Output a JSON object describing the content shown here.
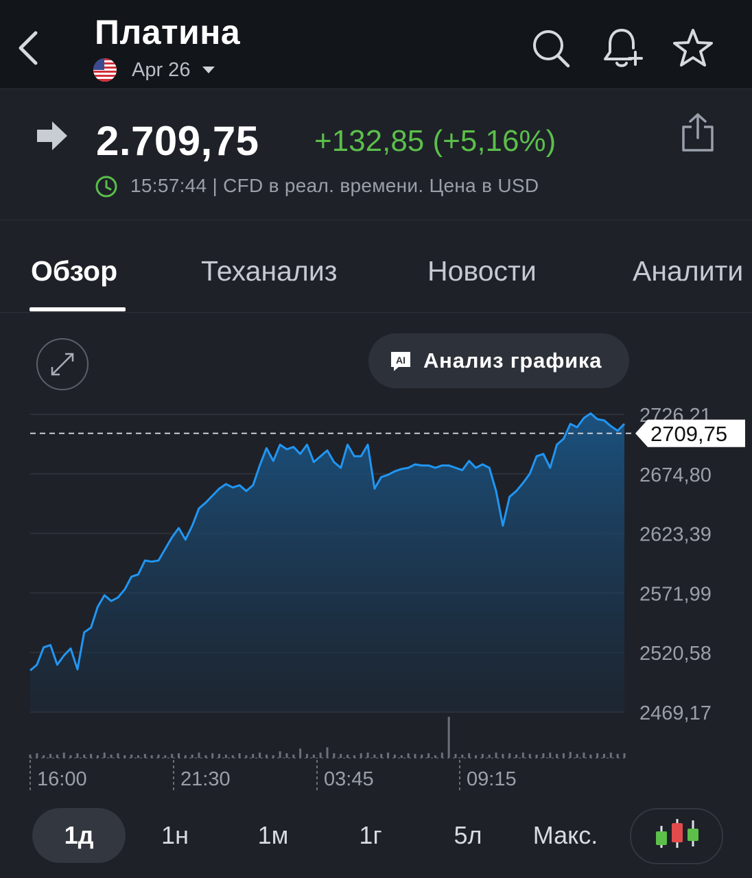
{
  "header": {
    "title": "Платина",
    "contract": "Apr 26"
  },
  "quote": {
    "price": "2.709,75",
    "change": "+132,85 (+5,16%)",
    "meta": "15:57:44 | CFD в реал. времени. Цена в USD",
    "colors": {
      "up": "#5bbf4a",
      "line": "#2196f3"
    }
  },
  "tabs": [
    {
      "label": "Обзор",
      "active": true
    },
    {
      "label": "Теханализ"
    },
    {
      "label": "Новости"
    },
    {
      "label": "Аналити"
    }
  ],
  "chart_tools": {
    "ai_badge": "AI",
    "ai_label": "Анализ графика"
  },
  "chart_data": {
    "type": "area",
    "y_ticks": [
      "2726,21",
      "2674,80",
      "2623,39",
      "2571,99",
      "2520,58",
      "2469,17"
    ],
    "y_tick_values": [
      2726.21,
      2674.8,
      2623.39,
      2571.99,
      2520.58,
      2469.17
    ],
    "x_ticks": [
      "16:00",
      "21:30",
      "03:45",
      "09:15"
    ],
    "current_value": 2709.75,
    "current_label": "2709,75",
    "ylim": [
      2469.17,
      2726.21
    ],
    "grid": true,
    "values": [
      2505,
      2510,
      2525,
      2527,
      2510,
      2518,
      2524,
      2506,
      2538,
      2542,
      2560,
      2570,
      2565,
      2568,
      2575,
      2586,
      2588,
      2600,
      2599,
      2600,
      2610,
      2620,
      2628,
      2618,
      2630,
      2645,
      2650,
      2656,
      2662,
      2666,
      2663,
      2665,
      2660,
      2665,
      2682,
      2697,
      2686,
      2700,
      2696,
      2698,
      2692,
      2700,
      2685,
      2690,
      2695,
      2685,
      2680,
      2700,
      2690,
      2690,
      2700,
      2662,
      2672,
      2674,
      2677,
      2679,
      2680,
      2683,
      2682,
      2682,
      2680,
      2682,
      2682,
      2680,
      2678,
      2686,
      2680,
      2683,
      2680,
      2660,
      2630,
      2655,
      2660,
      2667,
      2675,
      2690,
      2692,
      2680,
      2700,
      2705,
      2718,
      2715,
      2723,
      2727,
      2722,
      2721,
      2716,
      2712,
      2718
    ],
    "volume": [
      3,
      5,
      2,
      4,
      3,
      6,
      2,
      5,
      3,
      4,
      2,
      6,
      3,
      5,
      2,
      3,
      2,
      4,
      2,
      3,
      2,
      4,
      5,
      2,
      3,
      6,
      2,
      5,
      4,
      3,
      2,
      5,
      2,
      4,
      6,
      3,
      2,
      8,
      5,
      3,
      12,
      4,
      3,
      6,
      14,
      5,
      4,
      3,
      2,
      5,
      6,
      3,
      4,
      6,
      3,
      2,
      5,
      4,
      3,
      5,
      2,
      6,
      60,
      4,
      3,
      5,
      2,
      4,
      3,
      6,
      4,
      5,
      3,
      6,
      4,
      3,
      5,
      6,
      4,
      5,
      7,
      4,
      6,
      3,
      5,
      4,
      6,
      4,
      5
    ]
  },
  "ranges": [
    {
      "label": "1д",
      "active": true
    },
    {
      "label": "1н"
    },
    {
      "label": "1м"
    },
    {
      "label": "1г"
    },
    {
      "label": "5л"
    },
    {
      "label": "Макс."
    }
  ]
}
